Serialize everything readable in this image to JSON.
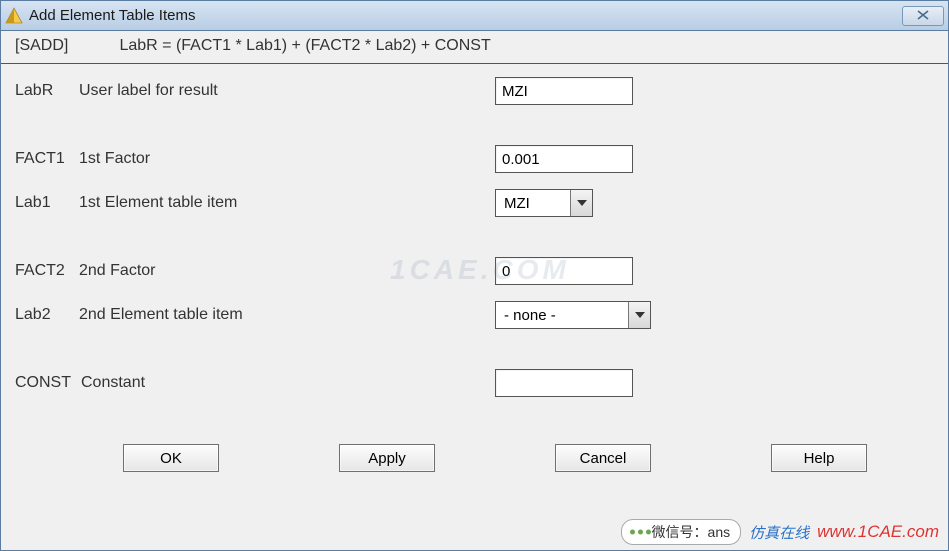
{
  "window": {
    "title": "Add Element Table Items"
  },
  "formula": {
    "command": "[SADD]",
    "expr": "LabR = (FACT1 * Lab1) + (FACT2 * Lab2) + CONST"
  },
  "fields": {
    "labr": {
      "key": "LabR",
      "label": "User label for result",
      "value": "MZI"
    },
    "fact1": {
      "key": "FACT1",
      "label": "1st Factor",
      "value": "0.001"
    },
    "lab1": {
      "key": "Lab1",
      "label": "1st Element table item",
      "value": "MZI"
    },
    "fact2": {
      "key": "FACT2",
      "label": "2nd Factor",
      "value": "0"
    },
    "lab2": {
      "key": "Lab2",
      "label": "2nd Element table item",
      "value": "- none -"
    },
    "const": {
      "key": "CONST",
      "label": "Constant",
      "value": ""
    }
  },
  "buttons": {
    "ok": "OK",
    "apply": "Apply",
    "cancel": "Cancel",
    "help": "Help"
  },
  "watermark": "1CAE.COM",
  "overlay": {
    "wechat_label": "微信号：ans",
    "cn_text": "仿真在线",
    "url": "www.1CAE.com"
  }
}
